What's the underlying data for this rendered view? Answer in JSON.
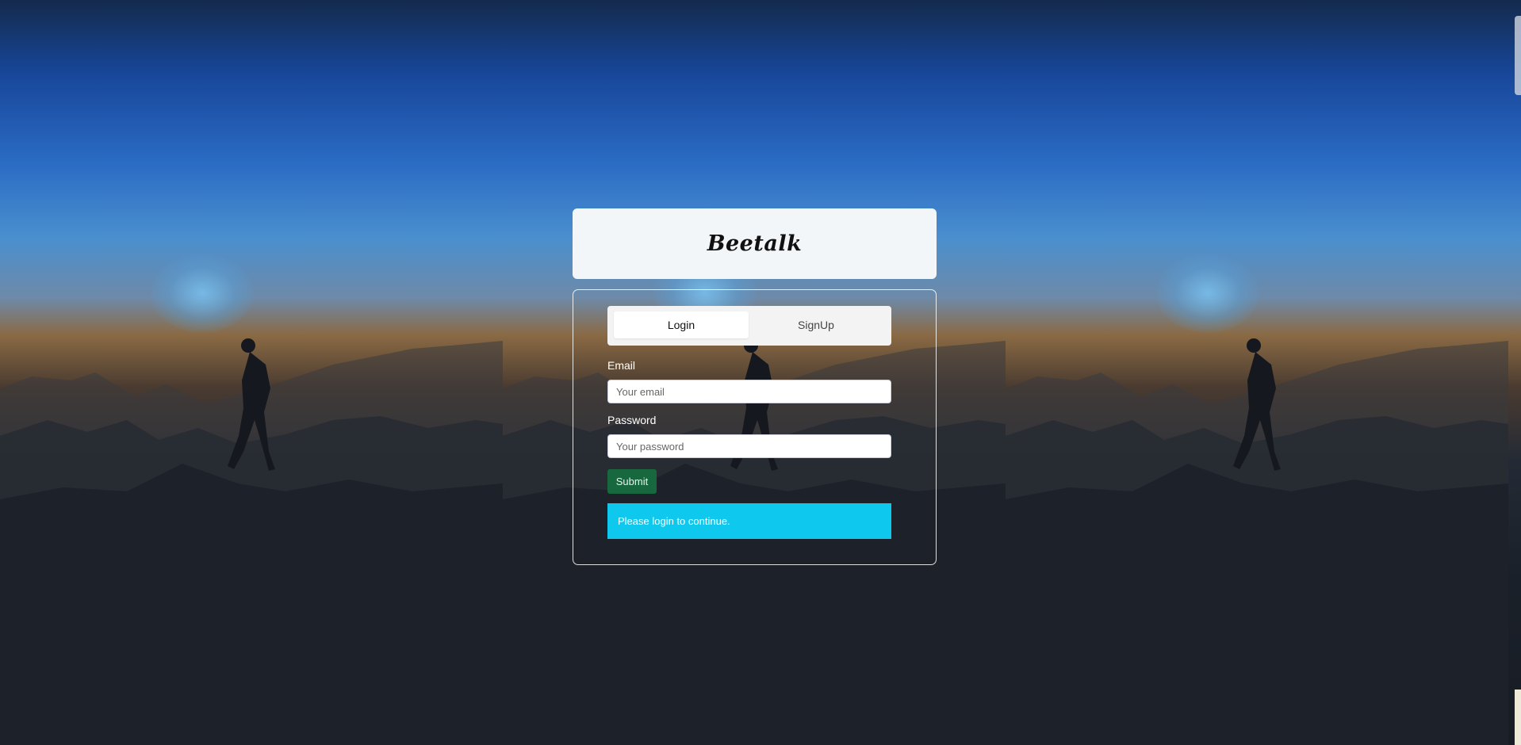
{
  "app": {
    "brand_title": "Beetalk"
  },
  "tabs": [
    {
      "label": "Login",
      "active": true
    },
    {
      "label": "SignUp",
      "active": false
    }
  ],
  "form": {
    "email_label": "Email",
    "email_placeholder": "Your email",
    "email_value": "",
    "password_label": "Password",
    "password_placeholder": "Your password",
    "password_value": "",
    "submit_label": "Submit"
  },
  "alert": {
    "message": "Please login to continue."
  },
  "colors": {
    "submit": "#17673f",
    "alert": "#0fc8ee",
    "brand_card": "#f2f6f9"
  },
  "icons": {
    "background": "silhouette-sunset-background"
  }
}
